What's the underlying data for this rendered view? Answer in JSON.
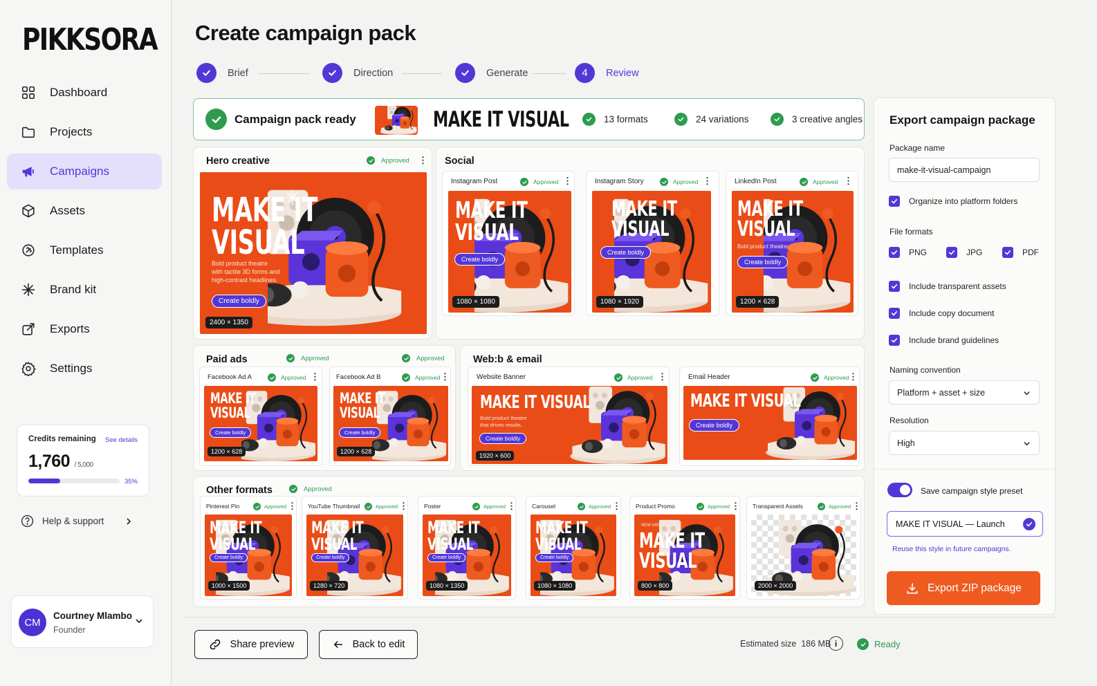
{
  "app": {
    "logo": "PIKKSORA"
  },
  "nav": {
    "items": [
      {
        "label": "Dashboard",
        "icon": "grid-icon"
      },
      {
        "label": "Projects",
        "icon": "folder-icon"
      },
      {
        "label": "Campaigns",
        "icon": "megaphone-icon",
        "active": true
      },
      {
        "label": "Assets",
        "icon": "cube-icon"
      },
      {
        "label": "Templates",
        "icon": "template-icon"
      },
      {
        "label": "Brand kit",
        "icon": "sparkle-icon"
      },
      {
        "label": "Exports",
        "icon": "export-icon"
      },
      {
        "label": "Settings",
        "icon": "gear-icon"
      }
    ]
  },
  "credits": {
    "title": "Credits remaining",
    "link": "See details",
    "value": "1,760",
    "total": "/ 5,000",
    "percent": "35%",
    "fraction": 0.35
  },
  "help": {
    "label": "Help & support"
  },
  "user": {
    "initials": "CM",
    "name": "Courtney Mlambo",
    "role": "Founder"
  },
  "page": {
    "title": "Create campaign pack"
  },
  "steps": [
    {
      "label": "Brief",
      "done": true
    },
    {
      "label": "Direction",
      "done": true
    },
    {
      "label": "Generate",
      "done": true
    },
    {
      "label": "Review",
      "number": "4",
      "current": true
    }
  ],
  "banner": {
    "status": "Campaign pack ready",
    "headline": "MAKE IT VISUAL",
    "stats": [
      "13 formats",
      "24 variations",
      "3 creative angles"
    ]
  },
  "approved": "Approved",
  "hero": {
    "section": "Hero creative",
    "headline": "MAKE IT\nVISUAL",
    "body": "Bold product theatre\nwith tactile 3D forms and\nhigh-contrast headlines.",
    "cta": "Create boldly",
    "size": "2400 × 1350"
  },
  "social": {
    "section": "Social",
    "tiles": [
      {
        "label": "Instagram Post",
        "headline": "MAKE IT\nVISUAL",
        "cta": "Create boldly",
        "size": "1080 × 1080"
      },
      {
        "label": "Instagram Story",
        "headline": "MAKE IT\nVISUAL",
        "cta": "Create boldly",
        "size": "1080 × 1920"
      },
      {
        "label": "LinkedIn Post",
        "headline": "MAKE IT\nVISUAL",
        "body": "Bold product theatre",
        "cta": "Create boldly",
        "size": "1200 × 628"
      }
    ]
  },
  "paid": {
    "section": "Paid ads",
    "tiles": [
      {
        "label": "Facebook Ad A",
        "headline": "MAKE IT\nVISUAL",
        "cta": "Create boldly",
        "size": "1200 × 628"
      },
      {
        "label": "Facebook Ad B",
        "headline": "MAKE IT\nVISUAL",
        "cta": "Create boldly",
        "size": "1200 × 628"
      }
    ]
  },
  "web": {
    "section": "Web:b & email",
    "tiles": [
      {
        "label": "Website Banner",
        "headline": "MAKE IT VISUAL",
        "body": "Bold product theatre\nthat drives results.",
        "cta": "Create boldly",
        "size": "1920 × 600"
      },
      {
        "label": "Email Header",
        "headline": "MAKE IT VISUAL",
        "cta": "Create boldly"
      }
    ]
  },
  "other": {
    "section": "Other formats",
    "tiles": [
      {
        "label": "Pinterest Pin",
        "headline": "MAKE IT\nVISUAL",
        "cta": "Create boldly",
        "size": "1000 × 1500"
      },
      {
        "label": "YouTube Thumbnail",
        "headline": "MAKE IT\nVISUAL",
        "cta": "Create boldly",
        "size": "1280 × 720"
      },
      {
        "label": "Poster",
        "headline": "MAKE IT\nVISUAL",
        "cta": "Create boldly",
        "size": "1080 × 1350"
      },
      {
        "label": "Carousel",
        "headline": "MAKE IT\nVISUAL",
        "cta": "Create boldly",
        "size": "1080 × 1080"
      },
      {
        "label": "Product Promo",
        "eyebrow": "NEW ARRIVAL",
        "headline": "MAKE IT\nVISUAL",
        "size": "800 × 800"
      },
      {
        "label": "Transparent Assets",
        "size": "2000 × 2000"
      }
    ]
  },
  "export": {
    "title": "Export campaign package",
    "package_label": "Package name",
    "package_value": "make-it-visual-campaign",
    "organize": "Organize into platform folders",
    "formats_label": "File formats",
    "formats": [
      "PNG",
      "JPG",
      "PDF"
    ],
    "options": [
      "Include transparent assets",
      "Include copy document",
      "Include brand guidelines"
    ],
    "naming_label": "Naming convention",
    "naming_value": "Platform + asset + size",
    "resolution_label": "Resolution",
    "resolution_value": "High",
    "preset_toggle": "Save campaign style preset",
    "preset_value": "MAKE IT VISUAL — Launch",
    "reuse": "Reuse this style in future campaigns.",
    "button": "Export ZIP package"
  },
  "footer": {
    "share": "Share preview",
    "back": "Back to edit",
    "estimate": "Estimated size  186 MB",
    "status": "Ready"
  },
  "colors": {
    "accent": "#5237d6",
    "brand_orange": "#ea4c17",
    "success": "#2e9b4e"
  }
}
